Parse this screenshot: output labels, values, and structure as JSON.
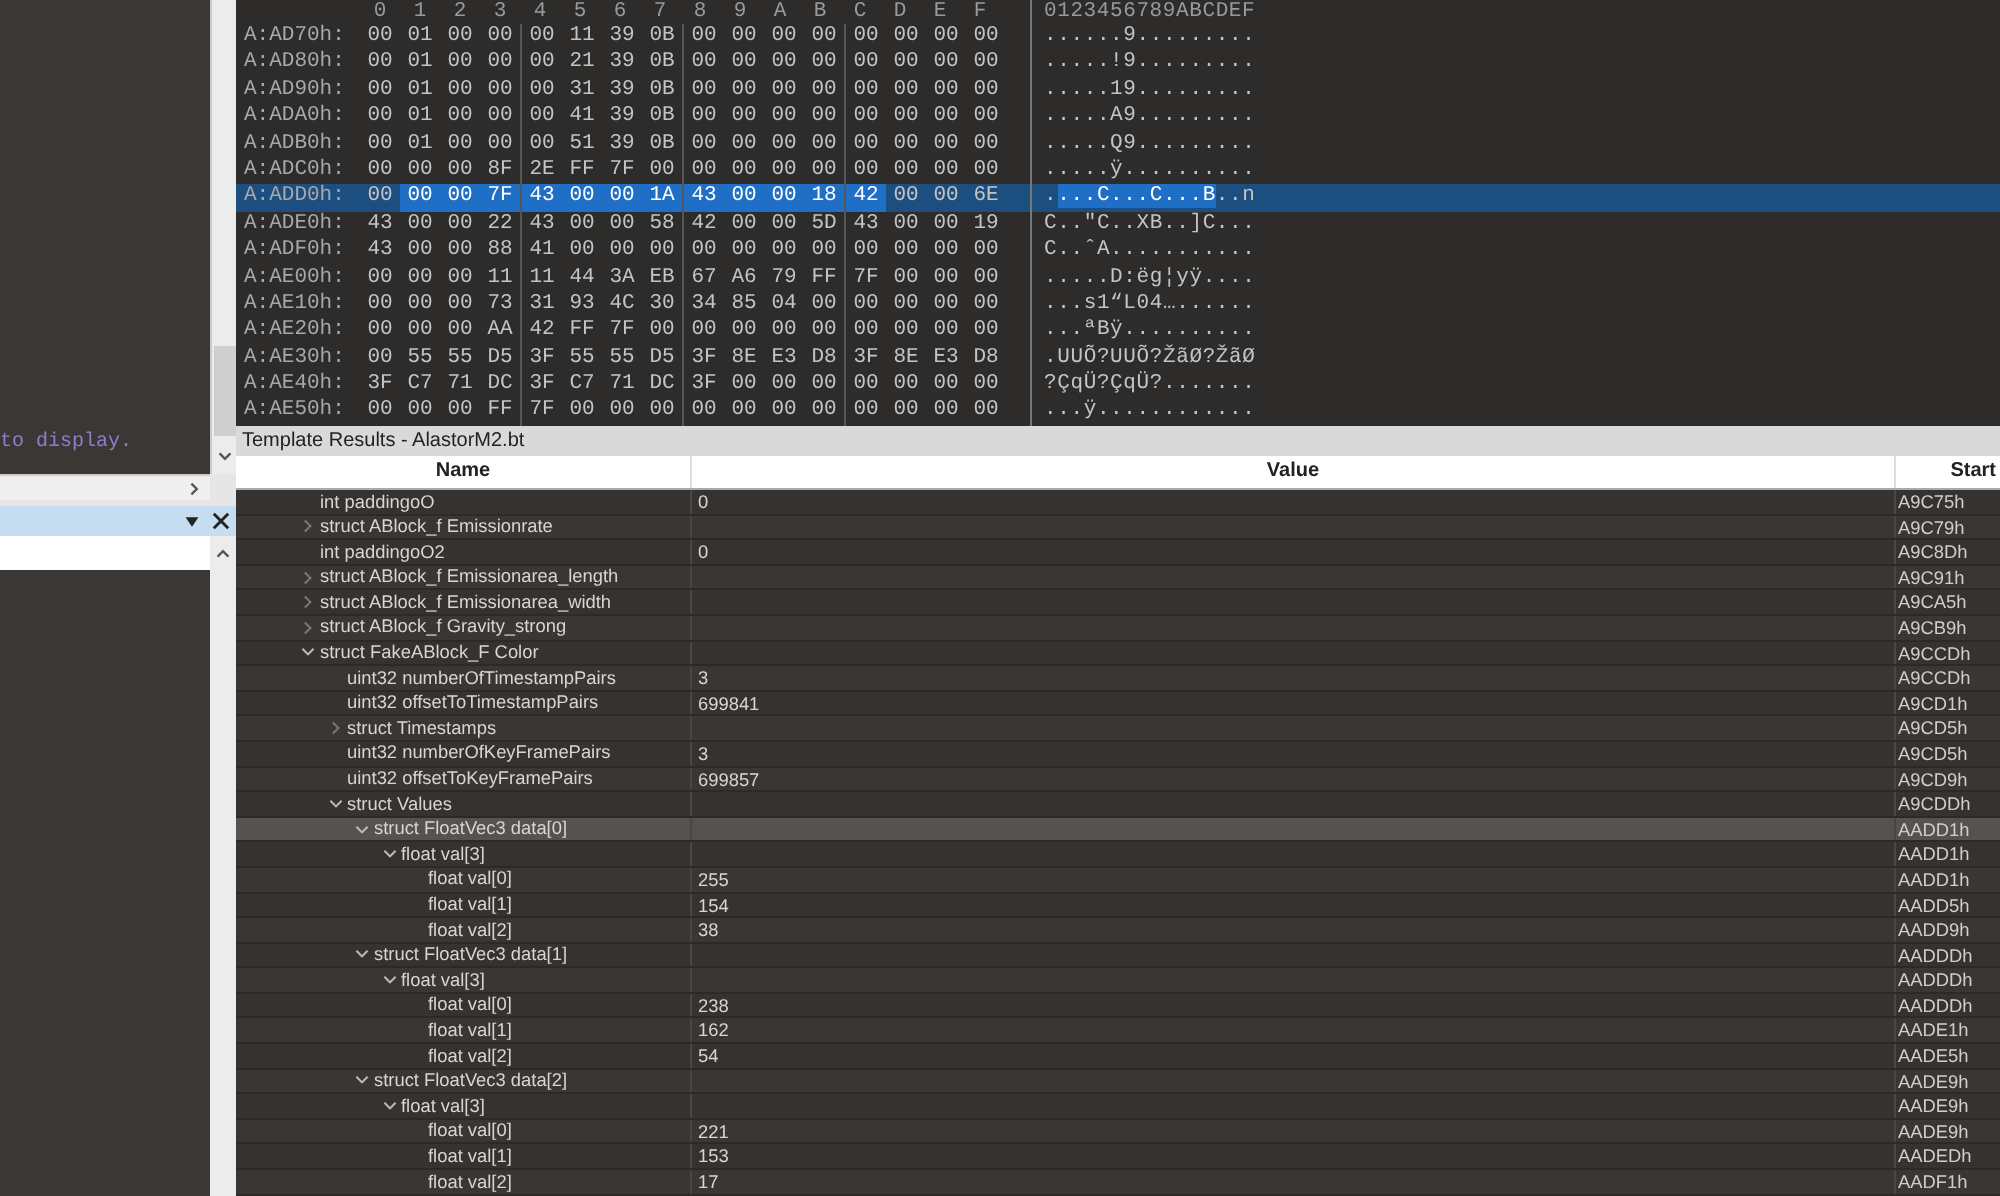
{
  "left_panel": {
    "message": "to display."
  },
  "hex": {
    "columns": [
      "0",
      "1",
      "2",
      "3",
      "4",
      "5",
      "6",
      "7",
      "8",
      "9",
      "A",
      "B",
      "C",
      "D",
      "E",
      "F"
    ],
    "ascii_header": "0123456789ABCDEF",
    "rows": [
      {
        "address": "A:AD70h:",
        "bytes": [
          "00",
          "01",
          "00",
          "00",
          "00",
          "11",
          "39",
          "0B",
          "00",
          "00",
          "00",
          "00",
          "00",
          "00",
          "00",
          "00"
        ],
        "ascii": "......9.........",
        "selected": false
      },
      {
        "address": "A:AD80h:",
        "bytes": [
          "00",
          "01",
          "00",
          "00",
          "00",
          "21",
          "39",
          "0B",
          "00",
          "00",
          "00",
          "00",
          "00",
          "00",
          "00",
          "00"
        ],
        "ascii": ".....!9.........",
        "selected": false
      },
      {
        "address": "A:AD90h:",
        "bytes": [
          "00",
          "01",
          "00",
          "00",
          "00",
          "31",
          "39",
          "0B",
          "00",
          "00",
          "00",
          "00",
          "00",
          "00",
          "00",
          "00"
        ],
        "ascii": ".....19.........",
        "selected": false
      },
      {
        "address": "A:ADA0h:",
        "bytes": [
          "00",
          "01",
          "00",
          "00",
          "00",
          "41",
          "39",
          "0B",
          "00",
          "00",
          "00",
          "00",
          "00",
          "00",
          "00",
          "00"
        ],
        "ascii": ".....A9.........",
        "selected": false
      },
      {
        "address": "A:ADB0h:",
        "bytes": [
          "00",
          "01",
          "00",
          "00",
          "00",
          "51",
          "39",
          "0B",
          "00",
          "00",
          "00",
          "00",
          "00",
          "00",
          "00",
          "00"
        ],
        "ascii": ".....Q9.........",
        "selected": false
      },
      {
        "address": "A:ADC0h:",
        "bytes": [
          "00",
          "00",
          "00",
          "8F",
          "2E",
          "FF",
          "7F",
          "00",
          "00",
          "00",
          "00",
          "00",
          "00",
          "00",
          "00",
          "00"
        ],
        "ascii": ".....ÿ..........",
        "selected": false
      },
      {
        "address": "A:ADD0h:",
        "bytes": [
          "00",
          "00",
          "00",
          "7F",
          "43",
          "00",
          "00",
          "1A",
          "43",
          "00",
          "00",
          "18",
          "42",
          "00",
          "00",
          "6E"
        ],
        "ascii": "....C...C...B..n",
        "selected": true,
        "byte_selected": [
          false,
          true,
          true,
          true,
          true,
          true,
          true,
          true,
          true,
          true,
          true,
          true,
          true,
          false,
          false,
          false
        ]
      },
      {
        "address": "A:ADE0h:",
        "bytes": [
          "43",
          "00",
          "00",
          "22",
          "43",
          "00",
          "00",
          "58",
          "42",
          "00",
          "00",
          "5D",
          "43",
          "00",
          "00",
          "19"
        ],
        "ascii": "C..\"C..XB..]C...",
        "selected": false
      },
      {
        "address": "A:ADF0h:",
        "bytes": [
          "43",
          "00",
          "00",
          "88",
          "41",
          "00",
          "00",
          "00",
          "00",
          "00",
          "00",
          "00",
          "00",
          "00",
          "00",
          "00"
        ],
        "ascii": "C..ˆA...........",
        "selected": false
      },
      {
        "address": "A:AE00h:",
        "bytes": [
          "00",
          "00",
          "00",
          "11",
          "11",
          "44",
          "3A",
          "EB",
          "67",
          "A6",
          "79",
          "FF",
          "7F",
          "00",
          "00",
          "00"
        ],
        "ascii": ".....D:ëg¦yÿ....",
        "selected": false
      },
      {
        "address": "A:AE10h:",
        "bytes": [
          "00",
          "00",
          "00",
          "73",
          "31",
          "93",
          "4C",
          "30",
          "34",
          "85",
          "04",
          "00",
          "00",
          "00",
          "00",
          "00"
        ],
        "ascii": "...s1“L04…......",
        "selected": false
      },
      {
        "address": "A:AE20h:",
        "bytes": [
          "00",
          "00",
          "00",
          "AA",
          "42",
          "FF",
          "7F",
          "00",
          "00",
          "00",
          "00",
          "00",
          "00",
          "00",
          "00",
          "00"
        ],
        "ascii": "...ªBÿ..........",
        "selected": false
      },
      {
        "address": "A:AE30h:",
        "bytes": [
          "00",
          "55",
          "55",
          "D5",
          "3F",
          "55",
          "55",
          "D5",
          "3F",
          "8E",
          "E3",
          "D8",
          "3F",
          "8E",
          "E3",
          "D8"
        ],
        "ascii": ".UUÕ?UUÕ?ŽãØ?ŽãØ",
        "selected": false
      },
      {
        "address": "A:AE40h:",
        "bytes": [
          "3F",
          "C7",
          "71",
          "DC",
          "3F",
          "C7",
          "71",
          "DC",
          "3F",
          "00",
          "00",
          "00",
          "00",
          "00",
          "00",
          "00"
        ],
        "ascii": "?ÇqÜ?ÇqÜ?.......",
        "selected": false
      },
      {
        "address": "A:AE50h:",
        "bytes": [
          "00",
          "00",
          "00",
          "FF",
          "7F",
          "00",
          "00",
          "00",
          "00",
          "00",
          "00",
          "00",
          "00",
          "00",
          "00",
          "00"
        ],
        "ascii": "...ÿ............",
        "selected": false
      }
    ]
  },
  "template_results": {
    "title": "Template Results - AlastorM2.bt",
    "columns": [
      "Name",
      "Value",
      "Start"
    ],
    "rows": [
      {
        "name": "int paddingoO",
        "value": "0",
        "start": "A9C75h",
        "selected": false
      },
      {
        "name": "struct ABlock_f Emissionrate",
        "start": "A9C79h",
        "expanded": false,
        "selected": false
      },
      {
        "name": "int paddingoO2",
        "value": "0",
        "start": "A9C8Dh",
        "selected": false
      },
      {
        "name": "struct ABlock_f Emissionarea_length",
        "start": "A9C91h",
        "expanded": false,
        "selected": false
      },
      {
        "name": "struct ABlock_f Emissionarea_width",
        "start": "A9CA5h",
        "expanded": false,
        "selected": false
      },
      {
        "name": "struct ABlock_f Gravity_strong",
        "start": "A9CB9h",
        "expanded": false,
        "selected": false
      },
      {
        "name": "struct FakeABlock_F Color",
        "start": "A9CCDh",
        "expanded": true,
        "selected": false,
        "children": [
          {
            "name": "uint32 numberOfTimestampPairs",
            "value": "3",
            "start": "A9CCDh",
            "selected": false
          },
          {
            "name": "uint32 offsetToTimestampPairs",
            "value": "699841",
            "start": "A9CD1h",
            "selected": false
          },
          {
            "name": "struct Timestamps",
            "start": "A9CD5h",
            "expanded": false,
            "selected": false
          },
          {
            "name": "uint32 numberOfKeyFramePairs",
            "value": "3",
            "start": "A9CD5h",
            "selected": false
          },
          {
            "name": "uint32 offsetToKeyFramePairs",
            "value": "699857",
            "start": "A9CD9h",
            "selected": false
          },
          {
            "name": "struct Values",
            "start": "A9CDDh",
            "expanded": true,
            "selected": false,
            "children": [
              {
                "name": "struct FloatVec3 data[0]",
                "start": "AADD1h",
                "expanded": true,
                "selected": true,
                "children": [
                  {
                    "name": "float val[3]",
                    "start": "AADD1h",
                    "expanded": true,
                    "selected": false,
                    "children": [
                      {
                        "name": "float val[0]",
                        "value": "255",
                        "start": "AADD1h",
                        "selected": false
                      },
                      {
                        "name": "float val[1]",
                        "value": "154",
                        "start": "AADD5h",
                        "selected": false
                      },
                      {
                        "name": "float val[2]",
                        "value": "38",
                        "start": "AADD9h",
                        "selected": false
                      }
                    ]
                  }
                ]
              },
              {
                "name": "struct FloatVec3 data[1]",
                "start": "AADDDh",
                "expanded": true,
                "selected": false,
                "children": [
                  {
                    "name": "float val[3]",
                    "start": "AADDDh",
                    "expanded": true,
                    "selected": false,
                    "children": [
                      {
                        "name": "float val[0]",
                        "value": "238",
                        "start": "AADDDh",
                        "selected": false
                      },
                      {
                        "name": "float val[1]",
                        "value": "162",
                        "start": "AADE1h",
                        "selected": false
                      },
                      {
                        "name": "float val[2]",
                        "value": "54",
                        "start": "AADE5h",
                        "selected": false
                      }
                    ]
                  }
                ]
              },
              {
                "name": "struct FloatVec3 data[2]",
                "start": "AADE9h",
                "expanded": true,
                "selected": false,
                "children": [
                  {
                    "name": "float val[3]",
                    "start": "AADE9h",
                    "expanded": true,
                    "selected": false,
                    "children": [
                      {
                        "name": "float val[0]",
                        "value": "221",
                        "start": "AADE9h",
                        "selected": false
                      },
                      {
                        "name": "float val[1]",
                        "value": "153",
                        "start": "AADEDh",
                        "selected": false
                      },
                      {
                        "name": "float val[2]",
                        "value": "17",
                        "start": "AADF1h",
                        "selected": false
                      }
                    ]
                  }
                ]
              }
            ]
          }
        ]
      }
    ]
  }
}
